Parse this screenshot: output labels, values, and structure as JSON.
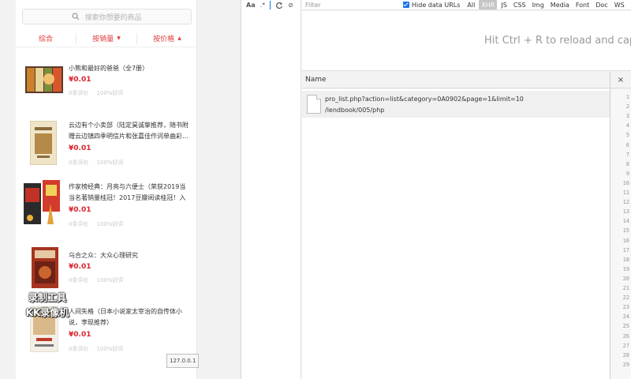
{
  "mobile": {
    "search_placeholder": "搜索你想要的商品",
    "sort_tabs": [
      {
        "label": "综合",
        "arrow": ""
      },
      {
        "label": "按销量",
        "arrow": "▼"
      },
      {
        "label": "按价格",
        "arrow": "▲"
      }
    ],
    "products": [
      {
        "title": "小熊和最好的爸爸（全7册）",
        "price": "¥0.01",
        "reviews": "0条评价",
        "positive": "100%好评"
      },
      {
        "title": "云边有个小卖部（陆定昊诚挚推荐，随书附赠云边镇四季明信片和张嘉佳作词单曲彩…",
        "price": "¥0.01",
        "reviews": "0条评价",
        "positive": "100%好评"
      },
      {
        "title": "作家榜经典：月亮与六便士（荣获2019当当名著销量桂冠！2017豆瓣阅读桂冠！入槛…",
        "price": "¥0.01",
        "reviews": "0条评价",
        "positive": "100%好评"
      },
      {
        "title": "乌合之众：大众心理研究",
        "price": "¥0.01",
        "reviews": "0条评价",
        "positive": "100%好评"
      },
      {
        "title": "人间失格（日本小说家太宰治的自传体小说，李现推荐）",
        "price": "¥0.01",
        "reviews": "0条评价",
        "positive": "100%好评"
      }
    ],
    "watermark_line1": "录制工具",
    "watermark_line2": "KK录像机",
    "host_tooltip": "127.0.0.1"
  },
  "devtools": {
    "left_tools": [
      "Aa",
      ".*"
    ],
    "filter_placeholder": "Filter",
    "hide_data_urls_label": "Hide data URLs",
    "filter_types": [
      "All",
      "XHR",
      "JS",
      "CSS",
      "Img",
      "Media",
      "Font",
      "Doc",
      "WS"
    ],
    "active_filter": "XHR",
    "reload_hint": "Hit Ctrl + R to reload and captur",
    "name_header": "Name",
    "close_label": "×",
    "request": {
      "line1": "pro_list.php?action=list&category=0A0902&page=1&limit=10",
      "line2": "/lendbook/005/php"
    },
    "line_numbers": [
      "1",
      "2",
      "3",
      "4",
      "5",
      "6",
      "7",
      "8",
      "9",
      "10",
      "11",
      "12",
      "13",
      "14",
      "15",
      "16",
      "17",
      "18",
      "19",
      "20",
      "21",
      "22",
      "23",
      "24",
      "25",
      "26",
      "27",
      "28",
      "29"
    ]
  },
  "colors": {
    "accent_red": "#e03b3b",
    "price_red": "#d9222a",
    "checkbox_blue": "#1a73e8"
  }
}
